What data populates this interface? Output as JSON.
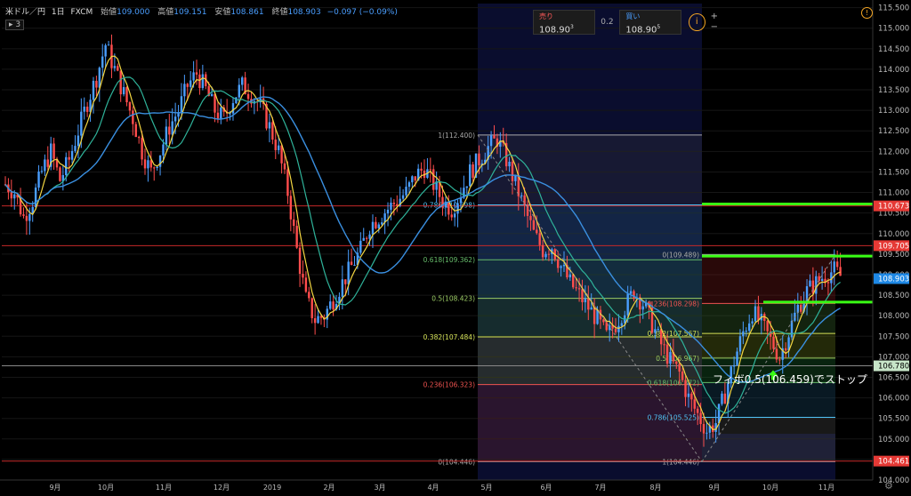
{
  "header": {
    "symbol": "米ドル／円",
    "interval": "1日",
    "source": "FXCM",
    "open_label": "始値",
    "open": "109.000",
    "high_label": "高値",
    "high": "109.151",
    "low_label": "安値",
    "low": "108.861",
    "close_label": "終値",
    "close": "108.903",
    "change": "−0.097 (−0.09%)",
    "indicator_toggle": "3"
  },
  "trade_panel": {
    "sell_label": "売り",
    "sell_price": "108.90",
    "sell_sup": "3",
    "spread": "0.2",
    "buy_label": "買い",
    "buy_price": "108.90",
    "buy_sup": "5",
    "info_icon": "i",
    "plus": "+",
    "minus": "−"
  },
  "colors": {
    "up": "#4a9eff",
    "down": "#ff4d4d",
    "ma_short": "#f5d742",
    "ma_mid": "#2fb39a",
    "ma_long": "#3a8fe0",
    "fib_line": "#8bc34a",
    "green_line": "#39ff14"
  },
  "chart_data": {
    "type": "candlestick",
    "symbol": "USD/JPY",
    "y_range": [
      104.0,
      115.6
    ],
    "price_axis_ticks": [
      "115.500",
      "115.000",
      "114.500",
      "114.000",
      "113.500",
      "113.000",
      "112.500",
      "112.000",
      "111.500",
      "111.000",
      "110.500",
      "110.000",
      "109.500",
      "109.000",
      "108.500",
      "108.000",
      "107.500",
      "107.000",
      "106.500",
      "106.000",
      "105.500",
      "105.000",
      "104.500",
      "104.000"
    ],
    "time_axis_labels": [
      "9月",
      "10月",
      "11月",
      "12月",
      "2019",
      "2月",
      "3月",
      "4月",
      "5月",
      "6月",
      "7月",
      "8月",
      "9月",
      "10月",
      "11月"
    ],
    "price_tags": [
      {
        "value": 110.673,
        "label": "110.673",
        "color": "#e53935"
      },
      {
        "value": 109.705,
        "label": "109.705",
        "color": "#e53935"
      },
      {
        "value": 108.903,
        "label": "108.903",
        "color": "#1e88e5"
      },
      {
        "value": 106.78,
        "label": "106.780",
        "color": "#c8e6c9"
      },
      {
        "value": 104.461,
        "label": "104.461",
        "color": "#e53935"
      }
    ],
    "fib_retracement_1": {
      "high": 112.4,
      "low": 104.446,
      "levels": [
        {
          "ratio": "1",
          "price": "112.400",
          "label": "1(112.400)"
        },
        {
          "ratio": "0.786",
          "price": "110.698",
          "label": "0.786(110.698)"
        },
        {
          "ratio": "0.618",
          "price": "109.362",
          "label": "0.618(109.362)"
        },
        {
          "ratio": "0.5",
          "price": "108.423",
          "label": "0.5(108.423)"
        },
        {
          "ratio": "0.382",
          "price": "107.484",
          "label": "0.382(107.484)"
        },
        {
          "ratio": "0.236",
          "price": "106.323",
          "label": "0.236(106.323)"
        },
        {
          "ratio": "0",
          "price": "104.446",
          "label": "0(104.446)"
        }
      ]
    },
    "fib_retracement_2": {
      "high": 109.489,
      "low": 104.446,
      "levels": [
        {
          "ratio": "0",
          "price": "109.489",
          "label": "0(109.489)"
        },
        {
          "ratio": "0.236",
          "price": "108.298",
          "label": "0.236(108.298)"
        },
        {
          "ratio": "0.382",
          "price": "107.567",
          "label": "0.382(107.567)"
        },
        {
          "ratio": "0.5",
          "price": "106.967",
          "label": "0.5(106.967)"
        },
        {
          "ratio": "0.618",
          "price": "106.372",
          "label": "0.618(106.372)"
        },
        {
          "ratio": "0.786",
          "price": "105.525",
          "label": "0.786(105.525)"
        },
        {
          "ratio": "1",
          "price": "104.446",
          "label": "1(104.446)"
        }
      ]
    },
    "horizontal_lines": [
      110.673,
      109.705,
      104.461,
      106.78
    ],
    "green_lines": [
      110.72,
      109.45,
      108.33
    ],
    "annotation": "フィボ0.5(106.459)でストップ",
    "candle_path": [
      111.2,
      111.0,
      110.4,
      110.8,
      111.5,
      112.0,
      111.3,
      111.8,
      112.5,
      113.2,
      113.8,
      114.6,
      114.0,
      113.4,
      112.8,
      112.0,
      111.5,
      112.0,
      112.6,
      113.0,
      113.6,
      113.9,
      113.5,
      113.0,
      112.8,
      113.3,
      113.6,
      113.4,
      113.1,
      112.6,
      112.0,
      111.0,
      109.6,
      108.4,
      107.9,
      108.0,
      108.4,
      108.8,
      109.2,
      109.6,
      110.2,
      110.4,
      110.6,
      110.8,
      111.0,
      111.4,
      111.6,
      111.2,
      110.8,
      110.6,
      111.0,
      111.5,
      111.8,
      112.1,
      112.3,
      111.8,
      111.2,
      110.6,
      110.0,
      109.6,
      109.7,
      109.2,
      108.8,
      108.5,
      108.2,
      107.9,
      107.5,
      107.8,
      108.2,
      108.6,
      108.3,
      107.8,
      107.3,
      106.9,
      106.6,
      106.0,
      105.6,
      105.2,
      105.4,
      106.1,
      106.9,
      107.6,
      108.1,
      107.8,
      107.4,
      107.0,
      107.6,
      108.2,
      108.6,
      108.8,
      109.0,
      109.1,
      108.9
    ],
    "moving_averages": [
      "short",
      "mid",
      "long"
    ]
  }
}
